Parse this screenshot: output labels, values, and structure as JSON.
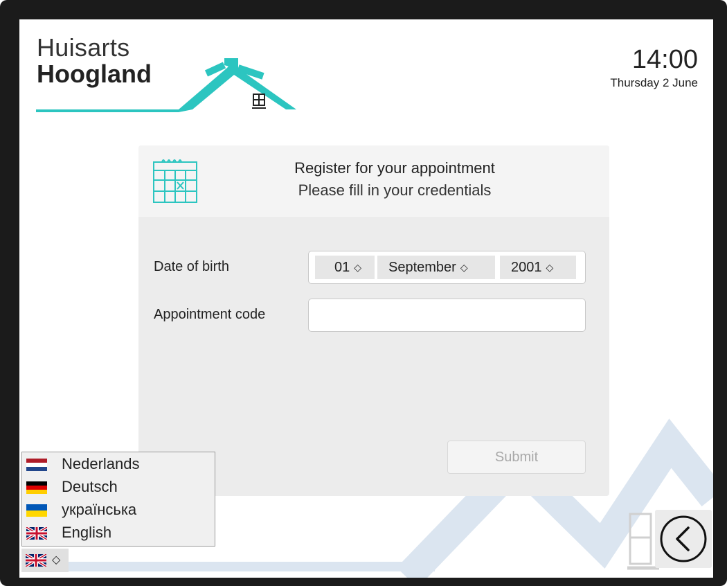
{
  "brand": {
    "line1": "Huisarts",
    "line2": "Hoogland",
    "accent": "#2cc5c0"
  },
  "clock": {
    "time": "14:00",
    "date": "Thursday 2 June"
  },
  "panel": {
    "icon": "calendar-icon",
    "title": "Register for your appointment",
    "subtitle": "Please fill in your credentials",
    "dob_label": "Date of birth",
    "day": "01",
    "month": "September",
    "year": "2001",
    "code_label": "Appointment code",
    "code_value": "",
    "submit_label": "Submit"
  },
  "language_menu": {
    "items": [
      {
        "label": "Nederlands",
        "icon": "flag-nl-icon"
      },
      {
        "label": "Deutsch",
        "icon": "flag-de-icon"
      },
      {
        "label": "українська",
        "icon": "flag-ua-icon"
      },
      {
        "label": "English",
        "icon": "flag-uk-icon"
      }
    ],
    "selected_icon": "flag-uk-icon"
  },
  "back": {
    "icon": "back-arrow-icon"
  },
  "colors": {
    "teal": "#2cc5c0",
    "background_lines": "#dde6f0"
  }
}
